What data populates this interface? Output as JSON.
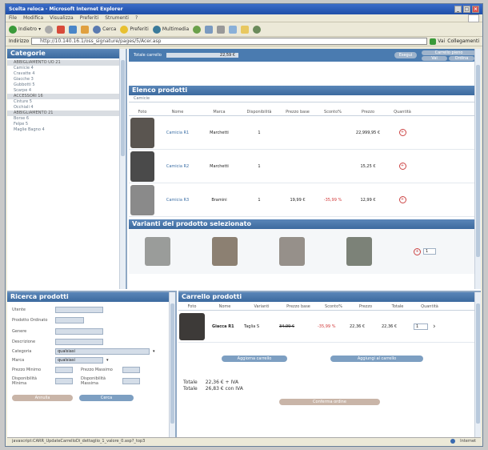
{
  "window": {
    "title": "Scelta reloca - Microsoft Internet Explorer"
  },
  "menu": [
    "File",
    "Modifica",
    "Visualizza",
    "Preferiti",
    "Strumenti",
    "?"
  ],
  "toolbar": {
    "back": "Indietro",
    "search": "Cerca",
    "favorites": "Preferiti",
    "multimedia": "Multimedia"
  },
  "address": {
    "label": "Indirizzo",
    "url": "http://10.140.16.1/oss_signature/pages/5/Acer.asp",
    "go": "Vai",
    "links": "Collegamenti"
  },
  "header": {
    "total_label": "Totale carrello",
    "total_value": "22,59 €",
    "btn1": "Esegui",
    "btn2": "Carrello pieno",
    "btn3": "Vai",
    "btn4": "Ordina"
  },
  "categories": {
    "title": "Categorie",
    "items": [
      {
        "label": "ABBIGLIAMENTO UO 21",
        "hl": true
      },
      {
        "label": "Camicie 4",
        "hl": false
      },
      {
        "label": "Cravatte 4",
        "hl": false
      },
      {
        "label": "Giacche 3",
        "hl": false
      },
      {
        "label": "Gubbotti 5",
        "hl": false
      },
      {
        "label": "Scarpe 4",
        "hl": false
      },
      {
        "label": "ACCESSORI 16",
        "hl": true
      },
      {
        "label": "Cinture 5",
        "hl": false
      },
      {
        "label": "Occhiali 4",
        "hl": false
      },
      {
        "label": "ABBIGLIAMENTO 21",
        "hl": true
      },
      {
        "label": "Borse 6",
        "hl": false
      },
      {
        "label": "Felpe 5",
        "hl": false
      },
      {
        "label": "Maglie Bagno 4",
        "hl": false
      }
    ]
  },
  "products": {
    "title": "Elenco prodotti",
    "subtitle": "Camicie",
    "columns": [
      "Foto",
      "Nome",
      "Marca",
      "Disponibilità",
      "Prezzo base",
      "Sconto%",
      "Prezzo",
      "Quantità"
    ],
    "rows": [
      {
        "name": "Camicia R1",
        "brand": "Marchetti",
        "avail": "1",
        "base": "",
        "discount": "",
        "price": "22,999,95 €",
        "color": "#5a5550"
      },
      {
        "name": "Camicia R2",
        "brand": "Marchetti",
        "avail": "1",
        "base": "",
        "discount": "",
        "price": "15,25 €",
        "color": "#4a4a4a"
      },
      {
        "name": "Camicia R3",
        "brand": "Bramini",
        "avail": "1",
        "base": "19,99 €",
        "discount": "-35,99 %",
        "price": "12,99 €",
        "color": "#8a8a8a"
      }
    ]
  },
  "variants": {
    "title": "Varianti del prodotto selezionato",
    "colors": [
      "#9a9c9a",
      "#8c8072",
      "#96908a",
      "#7c8278"
    ],
    "qty": "1"
  },
  "search": {
    "title": "Ricerca prodotti",
    "fields": [
      "Utente",
      "Prodotto Ordinato",
      "Genere",
      "Descrizione"
    ],
    "category_label": "Categoria",
    "category_value": "qualsiasi",
    "brand_label": "Marca",
    "brand_value": "qualsiasi",
    "price_min": "Prezzo Minimo",
    "price_max": "Prezzo Massimo",
    "avail_min": "Disponibilità Minima",
    "avail_max": "Disponibilità Massima",
    "reset": "Annulla",
    "submit": "Cerca"
  },
  "cart": {
    "title": "Carrello prodotti",
    "columns": [
      "Foto",
      "Nome",
      "Varianti",
      "Prezzo base",
      "Sconto%",
      "Prezzo",
      "Totale",
      "Quantità"
    ],
    "row": {
      "name": "Giacca R1",
      "variant": "Taglia S",
      "base": "34,99 €",
      "discount": "-35,99 %",
      "price": "22,36 €",
      "total": "22,36 €",
      "qty": "1"
    },
    "btn_update": "Aggiorna carrello",
    "btn_continue": "Aggiungi al carrello",
    "total_label": "Totale",
    "total1": "22,36 €  + IVA",
    "total2_label": "Totale",
    "total2": "26,83 €  con IVA",
    "btn_checkout": "Conferma ordine"
  },
  "statusbar": {
    "text": "javascript:CARR_UpdateCarrelloDi_dettaglio_1_valore_0.asp?_top3",
    "zone": "Internet"
  }
}
